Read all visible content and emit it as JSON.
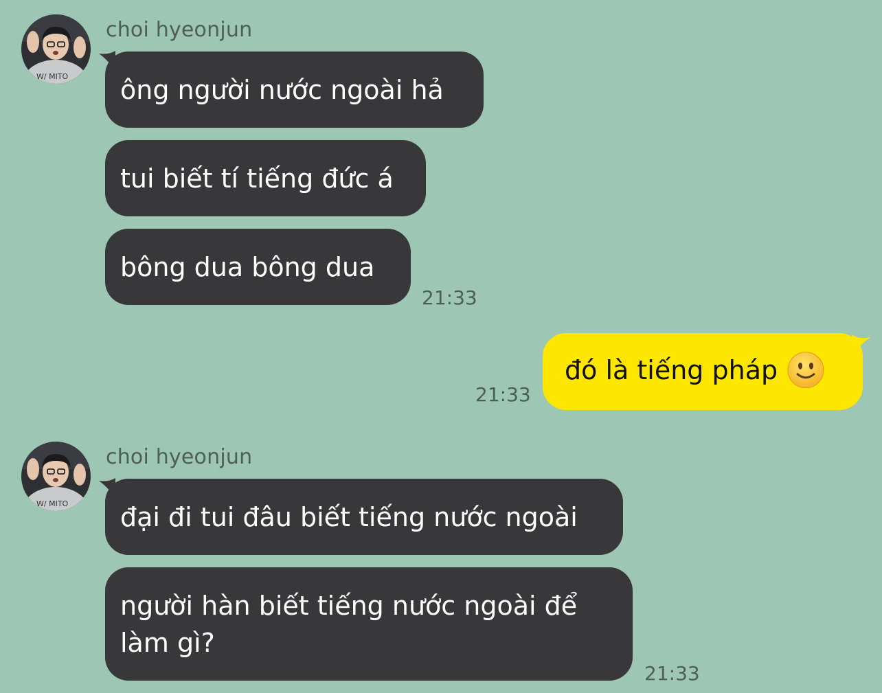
{
  "theme": {
    "background": "#9dc6b4",
    "incoming_bubble": "#38383a",
    "outgoing_bubble": "#fde700"
  },
  "groups": [
    {
      "sender": "choi hyeonjun",
      "avatar_icon": "user-avatar-photo",
      "messages": [
        "ông người nước ngoài hả",
        "tui biết tí tiếng đức á",
        "bông dua bông dua"
      ],
      "time": "21:33"
    },
    {
      "sender": "choi hyeonjun",
      "avatar_icon": "user-avatar-photo",
      "messages": [
        "đại đi tui đâu biết tiếng nước ngoài",
        "người hàn biết tiếng nước ngoài để làm gì?"
      ],
      "time": "21:33"
    }
  ],
  "outgoing": {
    "text": "đó là tiếng pháp",
    "emoji_icon": "slightly-smiling-face-icon",
    "time": "21:33"
  }
}
